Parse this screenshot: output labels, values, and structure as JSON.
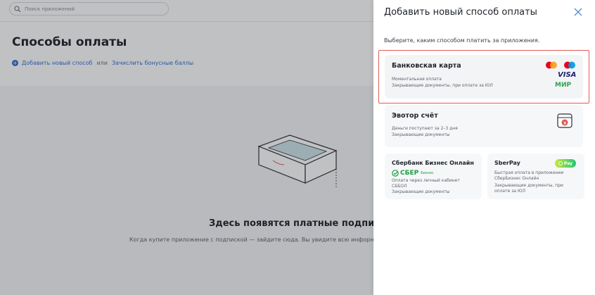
{
  "search": {
    "placeholder": "Поиск приложений"
  },
  "page": {
    "title": "Способы оплаты",
    "add_link": "Добавить новый способ",
    "or_text": "или",
    "bonus_link": "Зачислить бонусные баллы"
  },
  "empty": {
    "title": "Здесь появятся платные подпис",
    "subtitle": "Когда купите приложение с подпиской — зайдите сюда. Вы увидите всю инфорн"
  },
  "drawer": {
    "title": "Добавить новый способ оплаты",
    "subtitle": "Выберите, каким способом платить за приложения.",
    "bank_card": {
      "title": "Банковская карта",
      "desc1": "Моментальная оплата",
      "desc2": "Закрывающие документы, при оплате за ЮЛ",
      "visa": "VISA",
      "mir": "МИР"
    },
    "evotor": {
      "title": "Эвотор счёт",
      "desc1": "Деньги поступают за 2–3 дня",
      "desc2": "Закрывающие документы"
    },
    "sber_business": {
      "title": "Сбербанк Бизнес Онлайн",
      "logo_text": "СБЕР",
      "logo_sub": "Бизнес",
      "desc1": "Оплата через личный кабинет",
      "desc2": "СББОЛ",
      "desc3": "Закрывающие документы"
    },
    "sberpay": {
      "title": "SberPay",
      "badge": "Pay",
      "desc1": "Быстрая оплата в приложении",
      "desc2": "СберБизнес Онлайн",
      "desc3": "Закрывающие документы, при",
      "desc4": "оплате за ЮЛ"
    }
  },
  "colors": {
    "accent": "#2f6fd6",
    "selected_border": "#e35b54",
    "sber_green": "#1d9d3f"
  }
}
